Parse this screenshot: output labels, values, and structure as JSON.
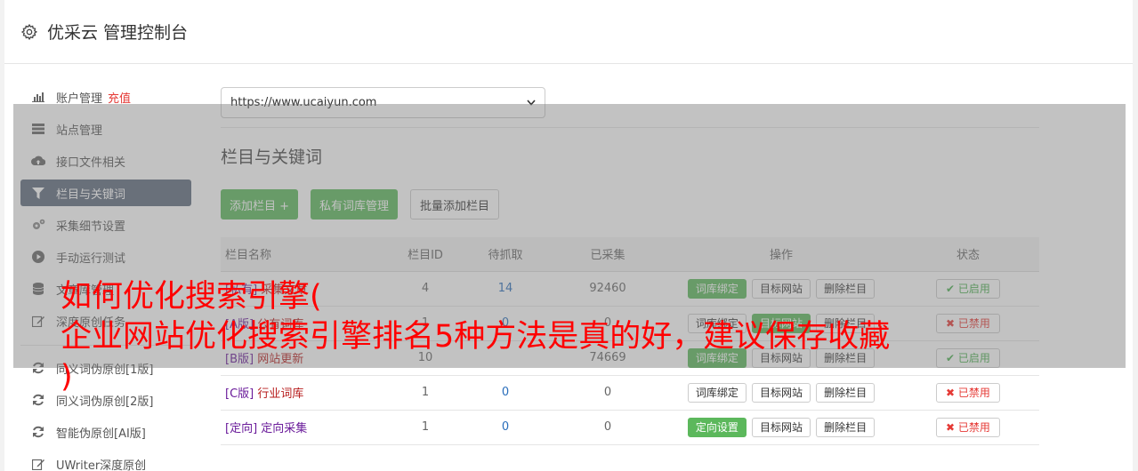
{
  "app": {
    "title": "优采云 管理控制台"
  },
  "sidebar": {
    "items": [
      {
        "label": "账户管理",
        "extra": "充值",
        "icon": "bar-chart-icon"
      },
      {
        "label": "站点管理",
        "icon": "server-icon"
      },
      {
        "label": "接口文件相关",
        "icon": "cloud-upload-icon"
      },
      {
        "label": "栏目与关键词",
        "icon": "filter-icon",
        "active": true
      },
      {
        "label": "采集细节设置",
        "icon": "gears-icon"
      },
      {
        "label": "手动运行测试",
        "icon": "play-icon"
      },
      {
        "label": "文章库管理",
        "icon": "database-icon"
      },
      {
        "label": "深度原创任务",
        "icon": "edit-icon"
      },
      {
        "label": "同义词伪原创[1版]",
        "icon": "refresh-icon"
      },
      {
        "label": "同义词伪原创[2版]",
        "icon": "refresh-icon"
      },
      {
        "label": "智能伪原创[AI版]",
        "icon": "refresh-icon"
      },
      {
        "label": "UWriter深度原创",
        "icon": "edit-icon"
      }
    ]
  },
  "main": {
    "site_select": "https://www.ucaiyun.com",
    "section_title": "栏目与关键词",
    "buttons": {
      "add": "添加栏目 +",
      "private_lib": "私有词库管理",
      "bulk_add": "批量添加栏目"
    },
    "table": {
      "headers": [
        "栏目名称",
        "栏目ID",
        "待抓取",
        "已采集",
        "操作",
        "状态"
      ],
      "rows": [
        {
          "tag": "[私有]",
          "name": "采集文章",
          "id": "4",
          "pending": "14",
          "collected": "92460",
          "ops": [
            "词库绑定",
            "目标网站",
            "删除栏目"
          ],
          "status": "已启用"
        },
        {
          "tag": "[A版]",
          "name": "公有词库",
          "id": "1",
          "pending": "0",
          "collected": "0",
          "ops": [
            "词库绑定",
            "目标网站",
            "删除栏目"
          ],
          "status": "已禁用"
        },
        {
          "tag": "[B版]",
          "name": "网站更新",
          "id": "10",
          "pending": "",
          "collected": "74669",
          "ops": [
            "词库绑定",
            "目标网站",
            "删除栏目"
          ],
          "status": "已启用"
        },
        {
          "tag": "[C版]",
          "name": "行业词库",
          "id": "1",
          "pending": "0",
          "collected": "0",
          "ops": [
            "词库绑定",
            "目标网站",
            "删除栏目"
          ],
          "status": "已禁用"
        },
        {
          "tag": "[定向]",
          "name": "定向采集",
          "id": "1",
          "pending": "0",
          "collected": "0",
          "ops": [
            "定向设置",
            "目标网站",
            "删除栏目"
          ],
          "status": "已禁用"
        }
      ]
    }
  },
  "overlay": {
    "line1": "如何优化搜索引擎(",
    "line2": "企业网站优化搜索引擎排名5种方法是真的好，建议保存收藏",
    "line3": ")"
  },
  "colors": {
    "accent_green": "#5cb85c",
    "active_nav": "#5e6b7c",
    "danger": "#e53935",
    "overlay_text": "#ff0000"
  }
}
